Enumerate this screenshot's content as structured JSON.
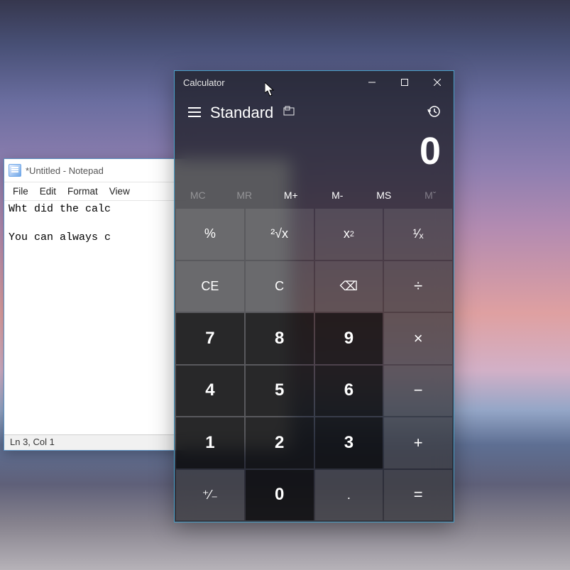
{
  "notepad": {
    "title": "*Untitled - Notepad",
    "menubar": [
      "File",
      "Edit",
      "Format",
      "View"
    ],
    "content": "Wht did the calc\n\nYou can always c",
    "status": "Ln 3, Col 1"
  },
  "calculator": {
    "title": "Calculator",
    "mode": "Standard",
    "display": "0",
    "memory": [
      {
        "label": "MC",
        "enabled": false
      },
      {
        "label": "MR",
        "enabled": false
      },
      {
        "label": "M+",
        "enabled": true
      },
      {
        "label": "M-",
        "enabled": true
      },
      {
        "label": "MS",
        "enabled": true
      },
      {
        "label": "Mˇ",
        "enabled": false
      }
    ],
    "keys": {
      "percent": "%",
      "root": "²√x",
      "square_base": "x",
      "square_exp": "2",
      "reciprocal": "¹⁄ₓ",
      "ce": "CE",
      "c": "C",
      "backspace": "⌫",
      "divide": "÷",
      "multiply": "×",
      "minus": "−",
      "plus": "+",
      "equals": "=",
      "negate": "⁺⁄₋",
      "dot": ".",
      "n0": "0",
      "n1": "1",
      "n2": "2",
      "n3": "3",
      "n4": "4",
      "n5": "5",
      "n6": "6",
      "n7": "7",
      "n8": "8",
      "n9": "9"
    }
  }
}
